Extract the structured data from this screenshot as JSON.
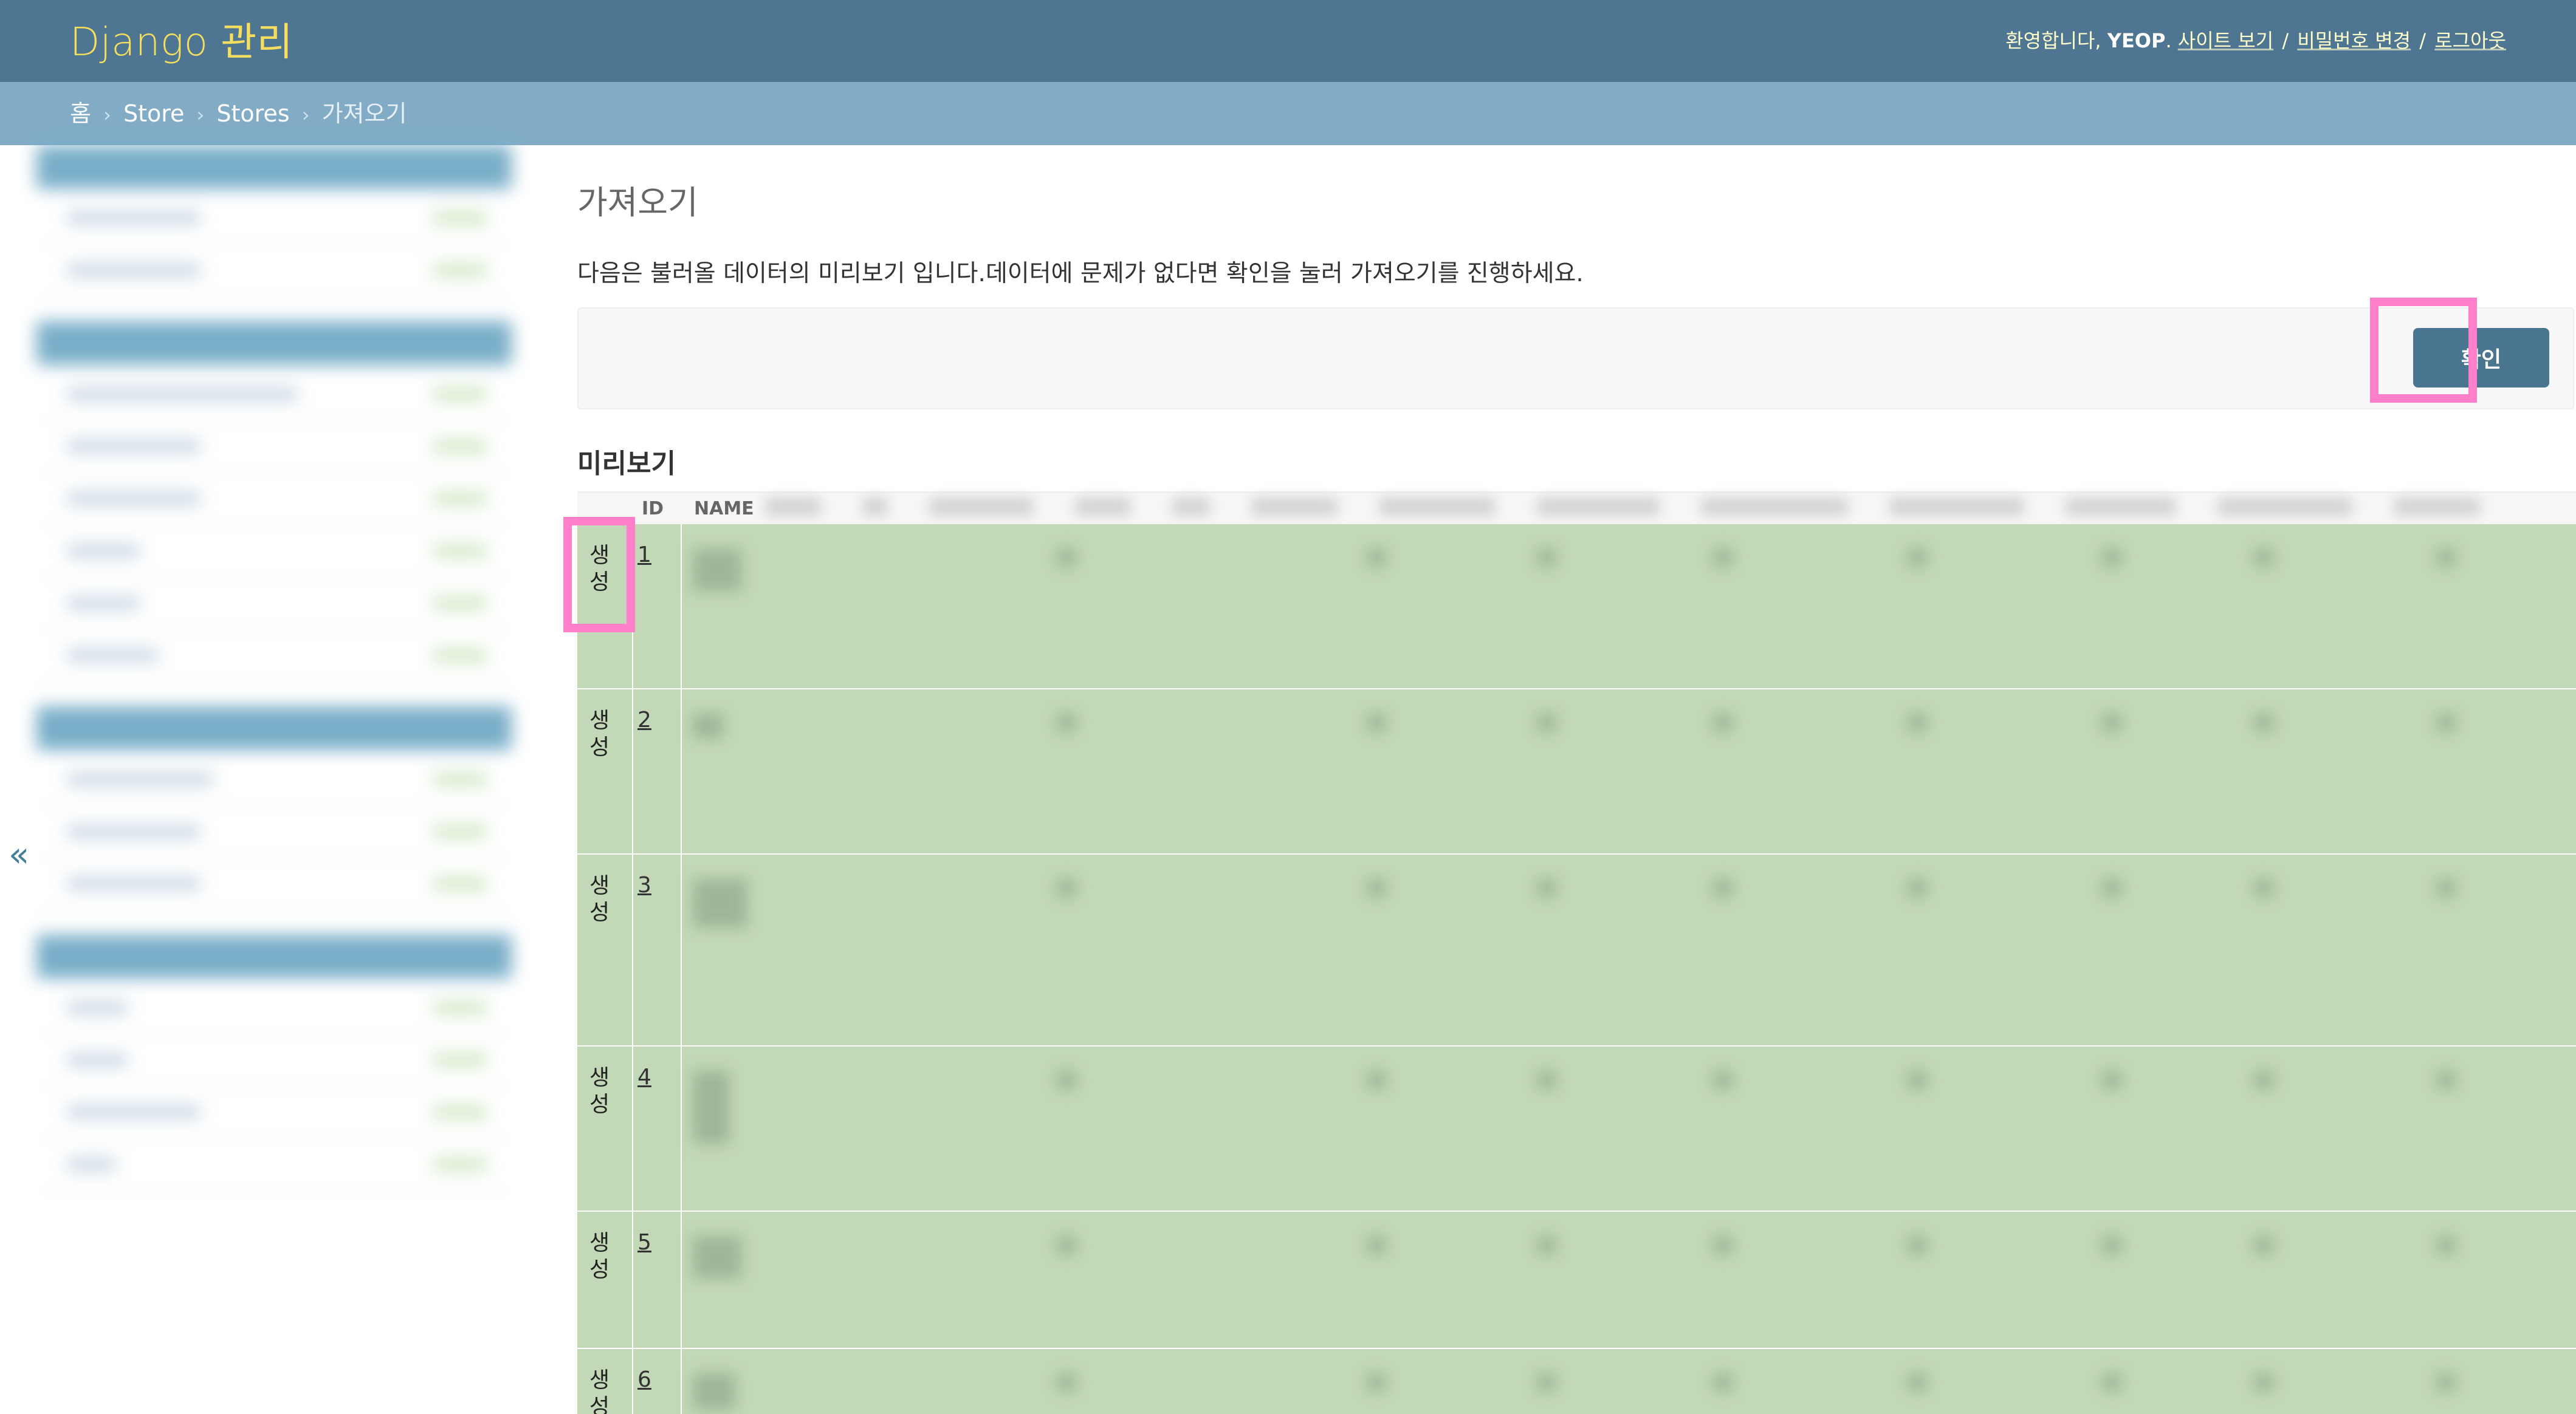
{
  "header": {
    "site_name": "Django 관리",
    "welcome_prefix": "환영합니다,",
    "username": "YEOP",
    "username_suffix": ".",
    "view_site": "사이트 보기",
    "change_password": "비밀번호 변경",
    "logout": "로그아웃",
    "separator": "/"
  },
  "breadcrumbs": {
    "home": "홈",
    "app": "Store",
    "model": "Stores",
    "current": "가져오기",
    "chevron": "›"
  },
  "sidebar": {
    "collapse_label": "«"
  },
  "main": {
    "title": "가져오기",
    "instruction": "다음은 불러올 데이터의 미리보기 입니다.데이터에 문제가 없다면 확인을 눌러 가져오기를 진행하세요.",
    "confirm_label": "확인",
    "preview_heading": "미리보기"
  },
  "table": {
    "columns": [
      "",
      "ID",
      "NAME"
    ],
    "rows": [
      {
        "type": "생성",
        "id": "1"
      },
      {
        "type": "생성",
        "id": "2"
      },
      {
        "type": "생성",
        "id": "3"
      },
      {
        "type": "생성",
        "id": "4"
      },
      {
        "type": "생성",
        "id": "5"
      },
      {
        "type": "생성",
        "id": "6"
      }
    ]
  },
  "colors": {
    "header_bg": "#4e7591",
    "site_name": "#f5dd5d",
    "breadcrumb_bg": "#82acc6",
    "new_row_bg": "#c3d8b6",
    "highlight": "#ff7fcb",
    "button_bg": "#4a7590"
  }
}
